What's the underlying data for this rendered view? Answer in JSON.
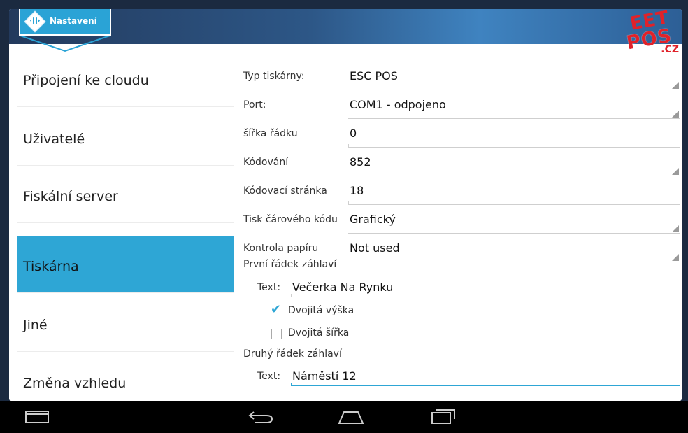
{
  "header": {
    "tab_title": "Nastavení",
    "logo_top": "EET",
    "logo_mid": "POS",
    "logo_suffix": ".CZ",
    "accent_color": "#2ea6d5",
    "brand_color": "#e0222a"
  },
  "sidebar": {
    "items": [
      {
        "label": "Připojení ke cloudu",
        "active": false
      },
      {
        "label": "Uživatelé",
        "active": false
      },
      {
        "label": "Fiskální server",
        "active": false
      },
      {
        "label": "Tiskárna",
        "active": true
      },
      {
        "label": "Jiné",
        "active": false
      },
      {
        "label": "Změna vzhledu",
        "active": false
      }
    ]
  },
  "form": {
    "rows": [
      {
        "label": "Typ tiskárny:",
        "value": "ESC POS",
        "kind": "select"
      },
      {
        "label": "Port:",
        "value": "COM1 - odpojeno",
        "kind": "select"
      },
      {
        "label": "šířka řádku",
        "value": "0",
        "kind": "input"
      },
      {
        "label": "Kódování",
        "value": "852",
        "kind": "select"
      },
      {
        "label": "Kódovací stránka",
        "value": "18",
        "kind": "input"
      },
      {
        "label": "Tisk čárového kódu",
        "value": "Grafický",
        "kind": "select"
      },
      {
        "label": "Kontrola papíru",
        "value": "Not used",
        "kind": "select"
      }
    ],
    "header1": {
      "title": "První řádek záhlaví",
      "text_label": "Text:",
      "text_value": "Večerka Na Rynku",
      "double_height_label": "Dvojitá výška",
      "double_height_checked": true,
      "double_width_label": "Dvojitá šířka",
      "double_width_checked": false
    },
    "header2": {
      "title": "Druhý řádek záhlaví",
      "text_label": "Text:",
      "text_value": "Náměstí 12"
    }
  },
  "navbar": {
    "icons": [
      "recent-apps-icon",
      "back-icon",
      "home-icon",
      "overview-icon"
    ]
  }
}
